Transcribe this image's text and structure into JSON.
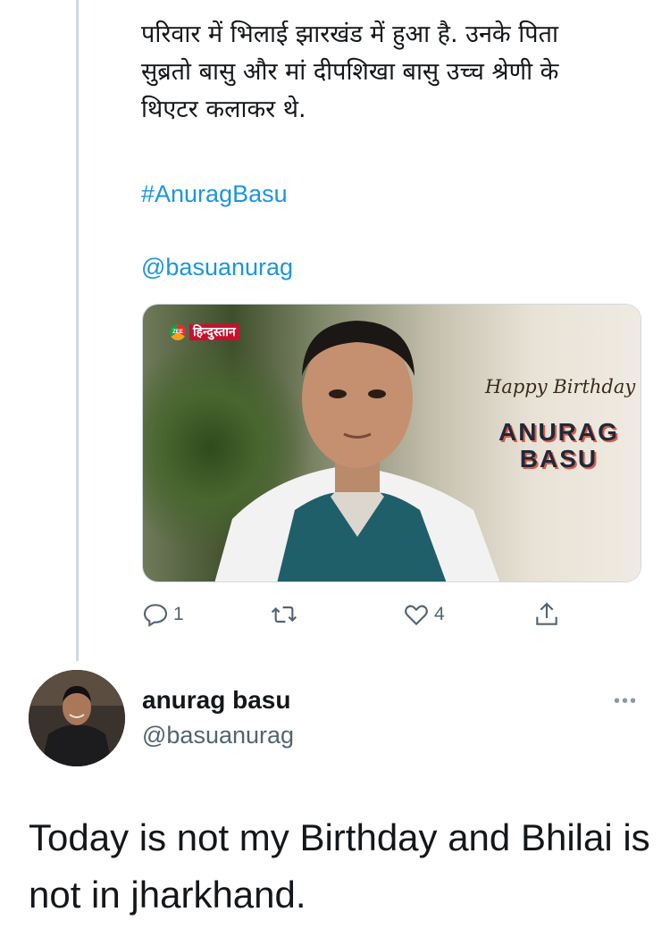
{
  "quoted_tweet": {
    "body_lines": [
      "परिवार में भिलाई झारखंड में हुआ है. उनके पिता",
      "सुब्रतो बासु और मां दीपशिखा बासु उच्च श्रेणी के",
      "थिएटर कलाकर थे."
    ],
    "hashtag": "#AnuragBasu",
    "mention": "@basuanurag",
    "media": {
      "logo_text": "हिन्दुस्तान",
      "logo_badge": "ZEE",
      "greeting": "Happy Birthday",
      "name_line1": "ANURAG",
      "name_line2": "BASU"
    },
    "actions": {
      "reply_count": "1",
      "retweet_count": "",
      "like_count": "4"
    }
  },
  "reply_tweet": {
    "author_name": "anurag basu",
    "author_handle": "@basuanurag",
    "more_label": "•••",
    "text": "Today is not my Birthday and Bhilai is not in jharkhand."
  },
  "colors": {
    "link": "#1b95e0",
    "muted": "#536471",
    "thread_line": "#cfd9de"
  }
}
